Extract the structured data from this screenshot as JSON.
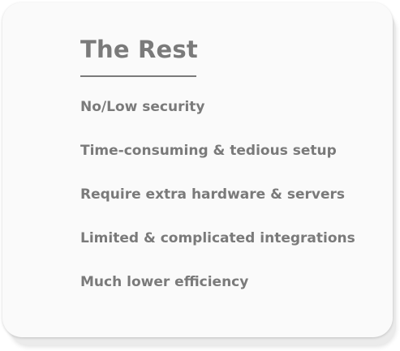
{
  "card": {
    "title": "The Rest",
    "features": [
      "No/Low security",
      "Time-consuming & tedious setup",
      "Require extra hardware & servers",
      "Limited & complicated integrations",
      "Much lower efficiency"
    ]
  },
  "colors": {
    "text": "#7a7a7a",
    "card_background": "#fafafa",
    "page_background": "#ffffff"
  }
}
